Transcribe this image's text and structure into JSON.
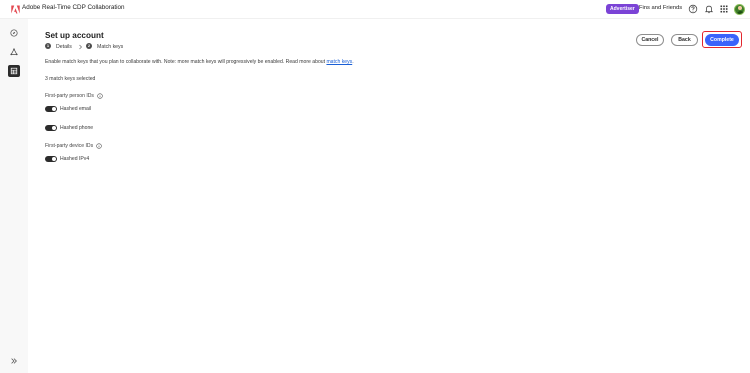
{
  "app": {
    "title": "Adobe Real-Time CDP Collaboration",
    "badge": "Advertiser",
    "org_name": "Fins and Friends",
    "brand_color": "#e34850",
    "badge_color": "#7b43d6"
  },
  "header_icons": [
    "help-icon",
    "bell-icon",
    "apps-grid-icon",
    "avatar"
  ],
  "rail": {
    "items": [
      {
        "icon": "compass-icon",
        "active": false
      },
      {
        "icon": "network-icon",
        "active": false
      },
      {
        "icon": "data-table-icon",
        "active": true
      }
    ],
    "expand_icon": "chevron-double-right-icon"
  },
  "page": {
    "title": "Set up account",
    "steps": [
      {
        "number": "1",
        "label": "Details"
      },
      {
        "number": "2",
        "label": "Match keys"
      }
    ],
    "buttons": {
      "cancel": "Cancel",
      "back": "Back",
      "complete": "Complete"
    },
    "description": "Enable match keys that you plan to collaborate with. Note: more match keys will progressively be enabled. Read more about ",
    "description_link": "match keys",
    "description_end": ".",
    "selected_count": "3 match keys selected",
    "sections": [
      {
        "title": "First-party person IDs",
        "keys": [
          {
            "label": "Hashed email",
            "enabled": true
          },
          {
            "label": "Hashed phone",
            "enabled": true
          }
        ]
      },
      {
        "title": "First-party device IDs",
        "keys": [
          {
            "label": "Hashed IPv4",
            "enabled": true
          }
        ]
      }
    ]
  },
  "colors": {
    "primary": "#3b63fb",
    "focus_ring": "#e3262e",
    "toggle_on": "#2c2c2c",
    "link": "#1a5fd6"
  }
}
